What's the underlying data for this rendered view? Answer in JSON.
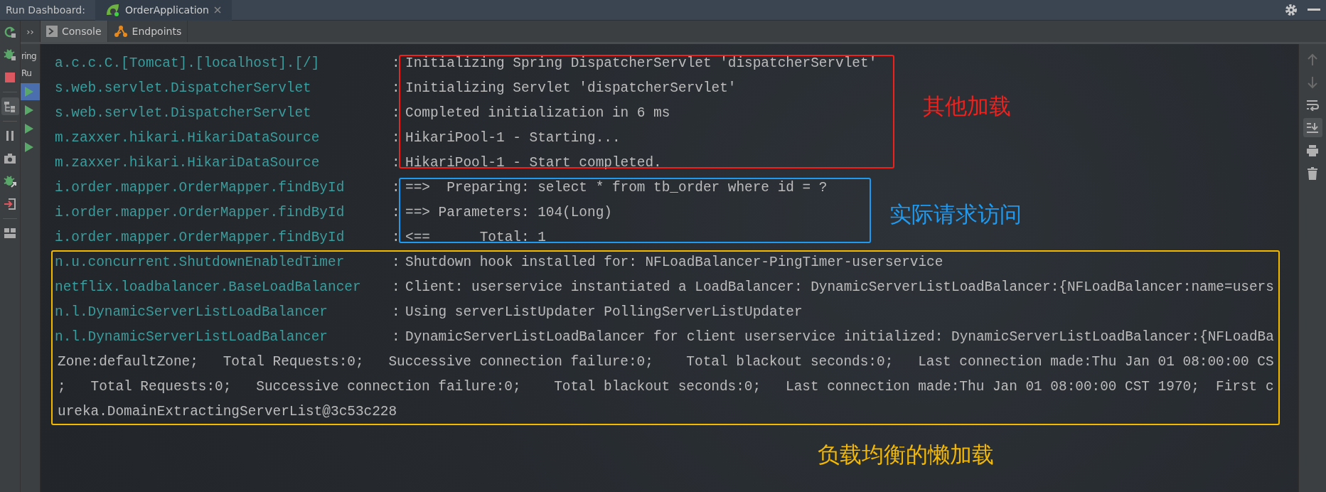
{
  "header": {
    "title": "Run Dashboard:",
    "tabs": [
      {
        "label": "OrderApplication",
        "selected": true
      }
    ]
  },
  "left_toolbar": [
    {
      "kind": "rerun",
      "selected": false
    },
    {
      "kind": "debug",
      "selected": false
    },
    {
      "kind": "stop",
      "selected": false
    },
    {
      "kind": "divider"
    },
    {
      "kind": "tree",
      "selected": true
    },
    {
      "kind": "divider"
    },
    {
      "kind": "pause",
      "selected": false
    },
    {
      "kind": "camera",
      "selected": false
    },
    {
      "kind": "debug-export",
      "selected": false
    },
    {
      "kind": "exit",
      "selected": false
    },
    {
      "kind": "divider"
    },
    {
      "kind": "layout",
      "selected": false
    }
  ],
  "overflow_button": "››",
  "console_tabs": [
    {
      "kind": "console",
      "label": "Console",
      "selected": true
    },
    {
      "kind": "endpoints",
      "label": "Endpoints",
      "selected": false
    }
  ],
  "run_tree": {
    "labels": [
      "ring",
      "Ru"
    ],
    "entries": [
      {
        "selected": true
      },
      {
        "selected": false
      },
      {
        "selected": false
      },
      {
        "selected": false
      }
    ]
  },
  "log_groups": [
    {
      "kind": "messages",
      "annotation": {
        "label": "其他加载",
        "color": "#f0201c"
      },
      "lines": [
        {
          "kind": "entry",
          "logger": "a.c.c.C.[Tomcat].[localhost].[/]",
          "separator": ":",
          "message": "Initializing Spring DispatcherServlet 'dispatcherServlet'"
        },
        {
          "kind": "entry",
          "logger": "s.web.servlet.DispatcherServlet",
          "separator": ":",
          "message": "Initializing Servlet 'dispatcherServlet'"
        },
        {
          "kind": "entry",
          "logger": "s.web.servlet.DispatcherServlet",
          "separator": ":",
          "message": "Completed initialization in 6 ms"
        },
        {
          "kind": "entry",
          "logger": "m.zaxxer.hikari.HikariDataSource",
          "separator": ":",
          "message": "HikariPool-1 - Starting..."
        },
        {
          "kind": "entry",
          "logger": "m.zaxxer.hikari.HikariDataSource",
          "separator": ":",
          "message": "HikariPool-1 - Start completed."
        }
      ]
    },
    {
      "kind": "messages",
      "annotation": {
        "label": "实际请求访问",
        "color": "#1e9af0"
      },
      "lines": [
        {
          "kind": "entry",
          "logger": "i.order.mapper.OrderMapper.findById",
          "separator": ":",
          "message": "==>  Preparing: select * from tb_order where id = ?"
        },
        {
          "kind": "entry",
          "logger": "i.order.mapper.OrderMapper.findById",
          "separator": ":",
          "message": "==> Parameters: 104(Long)"
        },
        {
          "kind": "entry",
          "logger": "i.order.mapper.OrderMapper.findById",
          "separator": ":",
          "message": "<==      Total: 1"
        }
      ]
    },
    {
      "kind": "full",
      "annotation": {
        "label": "负载均衡的懒加载",
        "color": "#f5b800"
      },
      "lines": [
        {
          "kind": "entry",
          "logger": "n.u.concurrent.ShutdownEnabledTimer",
          "separator": ":",
          "message": "Shutdown hook installed for: NFLoadBalancer-PingTimer-userservice"
        },
        {
          "kind": "entry",
          "logger": "netflix.loadbalancer.BaseLoadBalancer",
          "separator": ":",
          "message": "Client: userservice instantiated a LoadBalancer: DynamicServerListLoadBalancer:{NFLoadBalancer:name=users"
        },
        {
          "kind": "entry",
          "logger": "n.l.DynamicServerListLoadBalancer",
          "separator": ":",
          "message": "Using serverListUpdater PollingServerListUpdater"
        },
        {
          "kind": "entry",
          "logger": "n.l.DynamicServerListLoadBalancer",
          "separator": ":",
          "message": "DynamicServerListLoadBalancer for client userservice initialized: DynamicServerListLoadBalancer:{NFLoadBa"
        },
        {
          "kind": "continuation",
          "text": "Zone:defaultZone;   Total Requests:0;   Successive connection failure:0;    Total blackout seconds:0;   Last connection made:Thu Jan 01 08:00:00 CS"
        },
        {
          "kind": "continuation",
          "text": ";   Total Requests:0;   Successive connection failure:0;    Total blackout seconds:0;   Last connection made:Thu Jan 01 08:00:00 CST 1970;  First c"
        },
        {
          "kind": "continuation",
          "text": "ureka.DomainExtractingServerList@3c53c228"
        }
      ]
    }
  ],
  "right_toolbar": [
    {
      "kind": "up",
      "disabled": true,
      "selected": false
    },
    {
      "kind": "down",
      "disabled": true,
      "selected": false
    },
    {
      "kind": "wrap",
      "disabled": false,
      "selected": false
    },
    {
      "kind": "scroll-end",
      "disabled": false,
      "selected": true
    },
    {
      "kind": "print",
      "disabled": false,
      "selected": false
    },
    {
      "kind": "trash",
      "disabled": false,
      "selected": false
    }
  ]
}
